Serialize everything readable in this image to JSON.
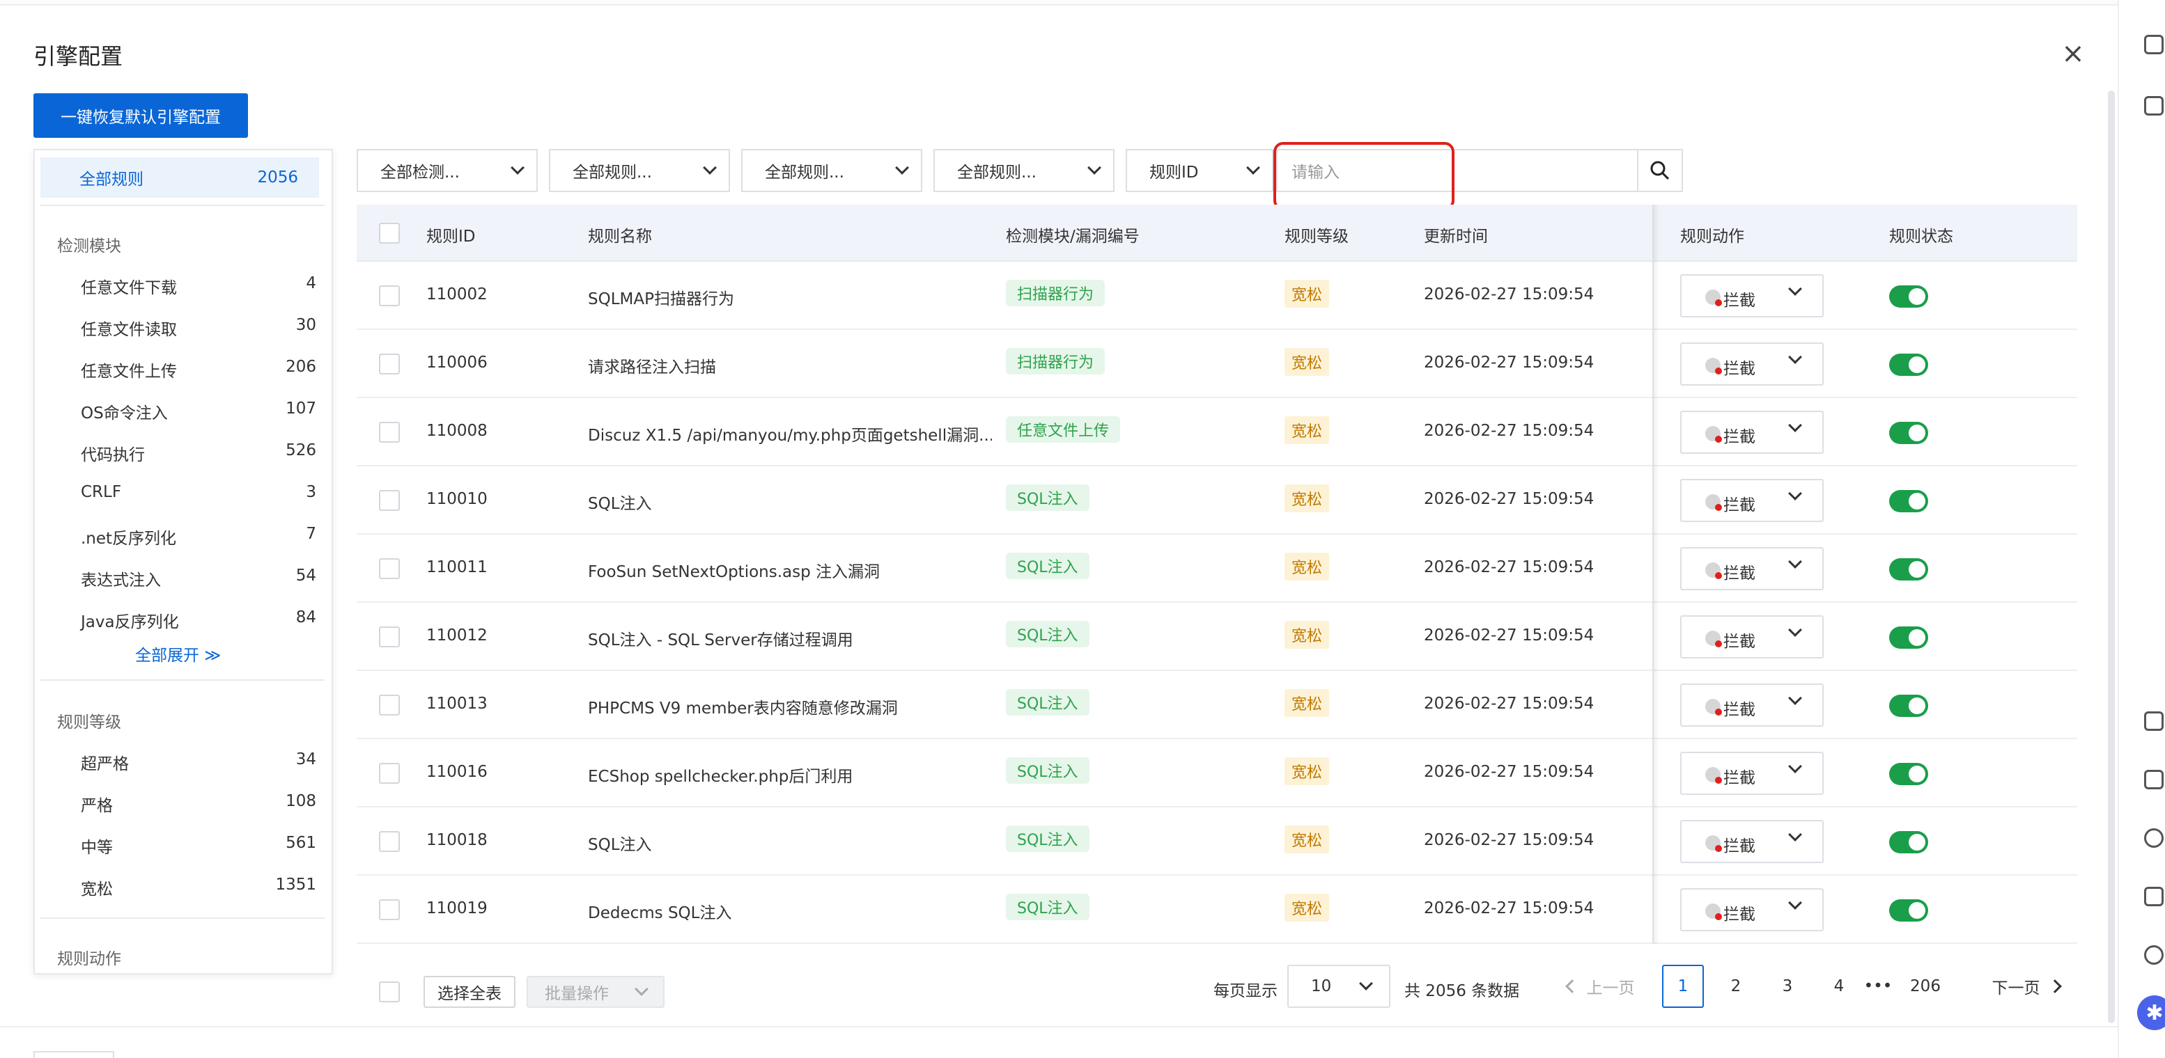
{
  "page": {
    "title": "引擎配置",
    "close_icon": "close-icon"
  },
  "restore_button": "一键恢复默认引擎配置",
  "sidebar": {
    "all": {
      "label": "全部规则",
      "count": "2056"
    },
    "sections": [
      {
        "title": "检测模块",
        "items": [
          {
            "label": "任意文件下载",
            "count": "4"
          },
          {
            "label": "任意文件读取",
            "count": "30"
          },
          {
            "label": "任意文件上传",
            "count": "206"
          },
          {
            "label": "OS命令注入",
            "count": "107"
          },
          {
            "label": "代码执行",
            "count": "526"
          },
          {
            "label": "CRLF",
            "count": "3"
          },
          {
            "label": ".net反序列化",
            "count": "7"
          },
          {
            "label": "表达式注入",
            "count": "54"
          },
          {
            "label": "Java反序列化",
            "count": "84"
          }
        ],
        "expand": "全部展开 ≫"
      },
      {
        "title": "规则等级",
        "items": [
          {
            "label": "超严格",
            "count": "34"
          },
          {
            "label": "严格",
            "count": "108"
          },
          {
            "label": "中等",
            "count": "561"
          },
          {
            "label": "宽松",
            "count": "1351"
          }
        ]
      },
      {
        "title": "规则动作",
        "items": []
      }
    ]
  },
  "filters": [
    "全部检测...",
    "全部规则...",
    "全部规则...",
    "全部规则...",
    "规则ID"
  ],
  "search": {
    "placeholder": "请输入",
    "icon": "search-icon"
  },
  "table": {
    "columns": [
      "规则ID",
      "规则名称",
      "检测模块/漏洞编号",
      "规则等级",
      "更新时间",
      "规则动作",
      "规则状态"
    ],
    "rows": [
      {
        "id": "110002",
        "name": "SQLMAP扫描器行为",
        "module": "扫描器行为",
        "level": "宽松",
        "time": "2026-02-27 15:09:54",
        "action": "拦截",
        "enabled": true
      },
      {
        "id": "110006",
        "name": "请求路径注入扫描",
        "module": "扫描器行为",
        "level": "宽松",
        "time": "2026-02-27 15:09:54",
        "action": "拦截",
        "enabled": true
      },
      {
        "id": "110008",
        "name": "Discuz X1.5 /api/manyou/my.php页面getshell漏洞...",
        "module": "任意文件上传",
        "level": "宽松",
        "time": "2026-02-27 15:09:54",
        "action": "拦截",
        "enabled": true
      },
      {
        "id": "110010",
        "name": "SQL注入",
        "module": "SQL注入",
        "level": "宽松",
        "time": "2026-02-27 15:09:54",
        "action": "拦截",
        "enabled": true
      },
      {
        "id": "110011",
        "name": "FooSun SetNextOptions.asp 注入漏洞",
        "module": "SQL注入",
        "level": "宽松",
        "time": "2026-02-27 15:09:54",
        "action": "拦截",
        "enabled": true
      },
      {
        "id": "110012",
        "name": "SQL注入 - SQL Server存储过程调用",
        "module": "SQL注入",
        "level": "宽松",
        "time": "2026-02-27 15:09:54",
        "action": "拦截",
        "enabled": true
      },
      {
        "id": "110013",
        "name": "PHPCMS V9 member表内容随意修改漏洞",
        "module": "SQL注入",
        "level": "宽松",
        "time": "2026-02-27 15:09:54",
        "action": "拦截",
        "enabled": true
      },
      {
        "id": "110016",
        "name": "ECShop spellchecker.php后门利用",
        "module": "SQL注入",
        "level": "宽松",
        "time": "2026-02-27 15:09:54",
        "action": "拦截",
        "enabled": true
      },
      {
        "id": "110018",
        "name": "SQL注入",
        "module": "SQL注入",
        "level": "宽松",
        "time": "2026-02-27 15:09:54",
        "action": "拦截",
        "enabled": true
      },
      {
        "id": "110019",
        "name": "Dedecms SQL注入",
        "module": "SQL注入",
        "level": "宽松",
        "time": "2026-02-27 15:09:54",
        "action": "拦截",
        "enabled": true
      }
    ]
  },
  "footer": {
    "select_all": "选择全表",
    "batch": "批量操作",
    "page_size_label": "每页显示",
    "page_size": "10",
    "total": "共 2056 条数据",
    "prev": "上一页",
    "pages": [
      "1",
      "2",
      "3",
      "4",
      "•••",
      "206"
    ],
    "current_page": "1",
    "next": "下一页"
  },
  "colors": {
    "accent": "#0a66d6",
    "toggle_on": "#1a9e4a",
    "highlight": "#e0201c"
  }
}
